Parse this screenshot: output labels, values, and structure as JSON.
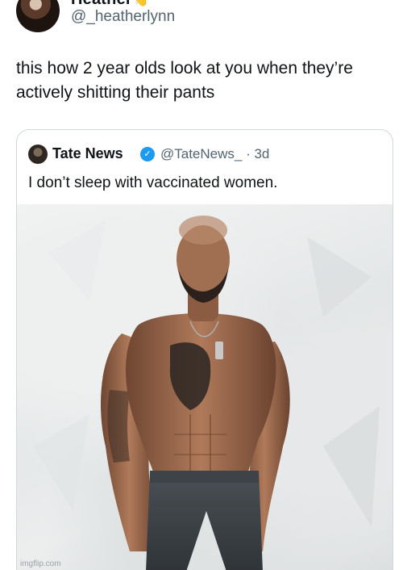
{
  "tweet": {
    "display_name": "Heather",
    "name_emoji": "👋",
    "handle": "@_heatherlynn",
    "text": "this how 2 year olds look at you when they’re actively shitting their pants"
  },
  "quote": {
    "name": "Tate News",
    "verified_mark": "✓",
    "handle_time": "@TateNews_ · 3d",
    "text": "I don’t sleep with vaccinated women."
  },
  "watermark": "imgflip.com",
  "colors": {
    "verified": "#1d9bf0",
    "secondary_text": "#536471",
    "border": "#cfd9de"
  }
}
